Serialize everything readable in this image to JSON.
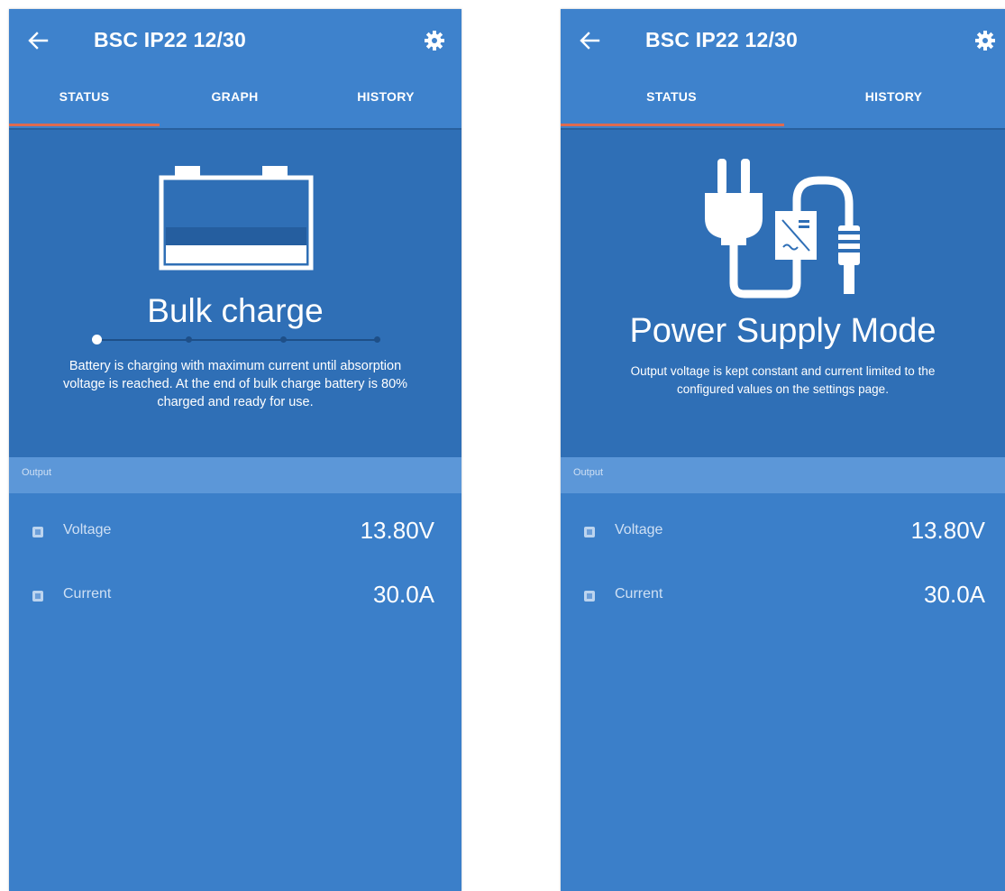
{
  "left_screen": {
    "title": "BSC IP22 12/30",
    "tabs": [
      {
        "label": "STATUS",
        "active": true
      },
      {
        "label": "GRAPH",
        "active": false
      },
      {
        "label": "HISTORY",
        "active": false
      }
    ],
    "state_icon": "battery-icon",
    "state_title": "Bulk charge",
    "progress_step": 1,
    "progress_steps_total": 4,
    "state_description": "Battery is charging with maximum current until absorption voltage is reached. At the end of bulk charge battery is 80% charged and ready for use.",
    "section_label": "Output",
    "readings": [
      {
        "label": "Voltage",
        "value": "13.80V"
      },
      {
        "label": "Current",
        "value": "30.0A"
      }
    ]
  },
  "right_screen": {
    "title": "BSC IP22 12/30",
    "tabs": [
      {
        "label": "STATUS",
        "active": true
      },
      {
        "label": "HISTORY",
        "active": false
      }
    ],
    "state_icon": "power-plug-icon",
    "state_title": "Power Supply Mode",
    "state_description": "Output voltage is kept constant and current limited to the configured values on the settings page.",
    "section_label": "Output",
    "readings": [
      {
        "label": "Voltage",
        "value": "13.80V"
      },
      {
        "label": "Current",
        "value": "30.0A"
      }
    ]
  },
  "colors": {
    "app_background": "#3b7fc9",
    "hero_background": "#2f6fb6",
    "section_header": "#5c97d8",
    "tab_indicator": "#e06a4e",
    "text": "#ffffff"
  }
}
